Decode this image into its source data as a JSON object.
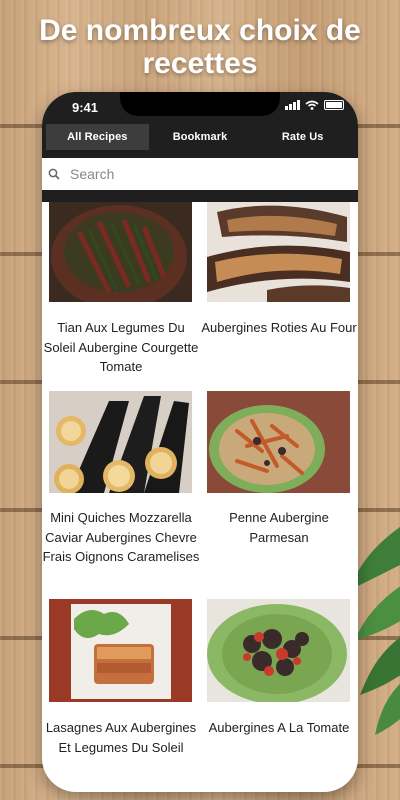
{
  "promo": {
    "headline": "De nombreux choix de recettes"
  },
  "status_bar": {
    "time": "9:41"
  },
  "tabs": [
    {
      "label": "All Recipes",
      "active": true
    },
    {
      "label": "Bookmark",
      "active": false
    },
    {
      "label": "Rate Us",
      "active": false
    }
  ],
  "search": {
    "placeholder": "Search",
    "value": ""
  },
  "recipes": [
    {
      "title": "Tian Aux Legumes Du Soleil Aubergine Courgette Tomate"
    },
    {
      "title": "Aubergines Roties Au Four"
    },
    {
      "title": "Mini Quiches Mozzarella Caviar Aubergines Chevre Frais Oignons Caramelises"
    },
    {
      "title": "Penne Aubergine Parmesan"
    },
    {
      "title": "Lasagnes Aux Aubergines Et Legumes Du Soleil"
    },
    {
      "title": "Aubergines A La Tomate"
    }
  ],
  "colors": {
    "header_bg": "#1f1f1f",
    "active_tab_bg": "#3d3d3d",
    "headline": "#ffffff"
  }
}
